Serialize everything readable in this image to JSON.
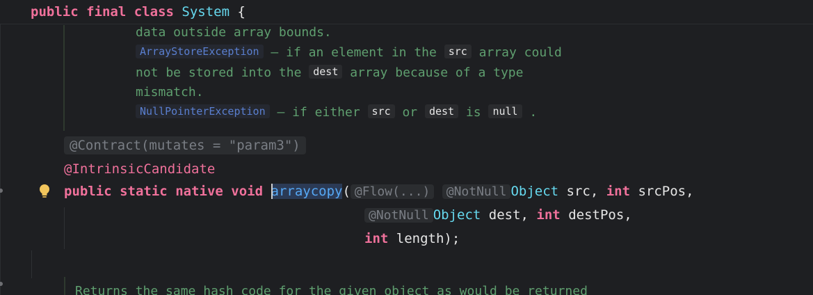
{
  "sticky": {
    "kw1": "public",
    "kw2": "final",
    "kw3": "class",
    "name": "System",
    "brace": "{"
  },
  "doc": {
    "line1": "data outside array bounds.",
    "l2_link": "ArrayStoreException",
    "l2_text_a": " – if an element in the ",
    "l2_code": "src",
    "l2_text_b": " array could",
    "line3_a": "not be stored into the ",
    "line3_code": "dest",
    "line3_b": " array because of a type",
    "line4": "mismatch.",
    "l5_link": "NullPointerException",
    "l5_text_a": " – if either ",
    "l5_code1": "src",
    "l5_text_b": " or ",
    "l5_code2": "dest",
    "l5_text_c": " is ",
    "l5_code3": "null",
    "l5_text_d": " ."
  },
  "code": {
    "contract_hint": "@Contract(mutates = \"param3\")",
    "intrinsic": "@IntrinsicCandidate",
    "sig_kw1": "public",
    "sig_kw2": "static",
    "sig_kw3": "native",
    "sig_kw4": "void",
    "method": "arraycopy",
    "paren": "(",
    "flow_hint": "@Flow(...)",
    "notnull_hint1": "@NotNull",
    "type1": "Object",
    "p1": " src, ",
    "int1": "int",
    "p2": " srcPos,",
    "notnull_hint2": "@NotNull",
    "type2": "Object",
    "p3": " dest, ",
    "int2": "int",
    "p4": " destPos,",
    "int3": "int",
    "p5": " length);"
  },
  "bottom": {
    "text": "Returns the same hash code for the given object as would be returned"
  }
}
